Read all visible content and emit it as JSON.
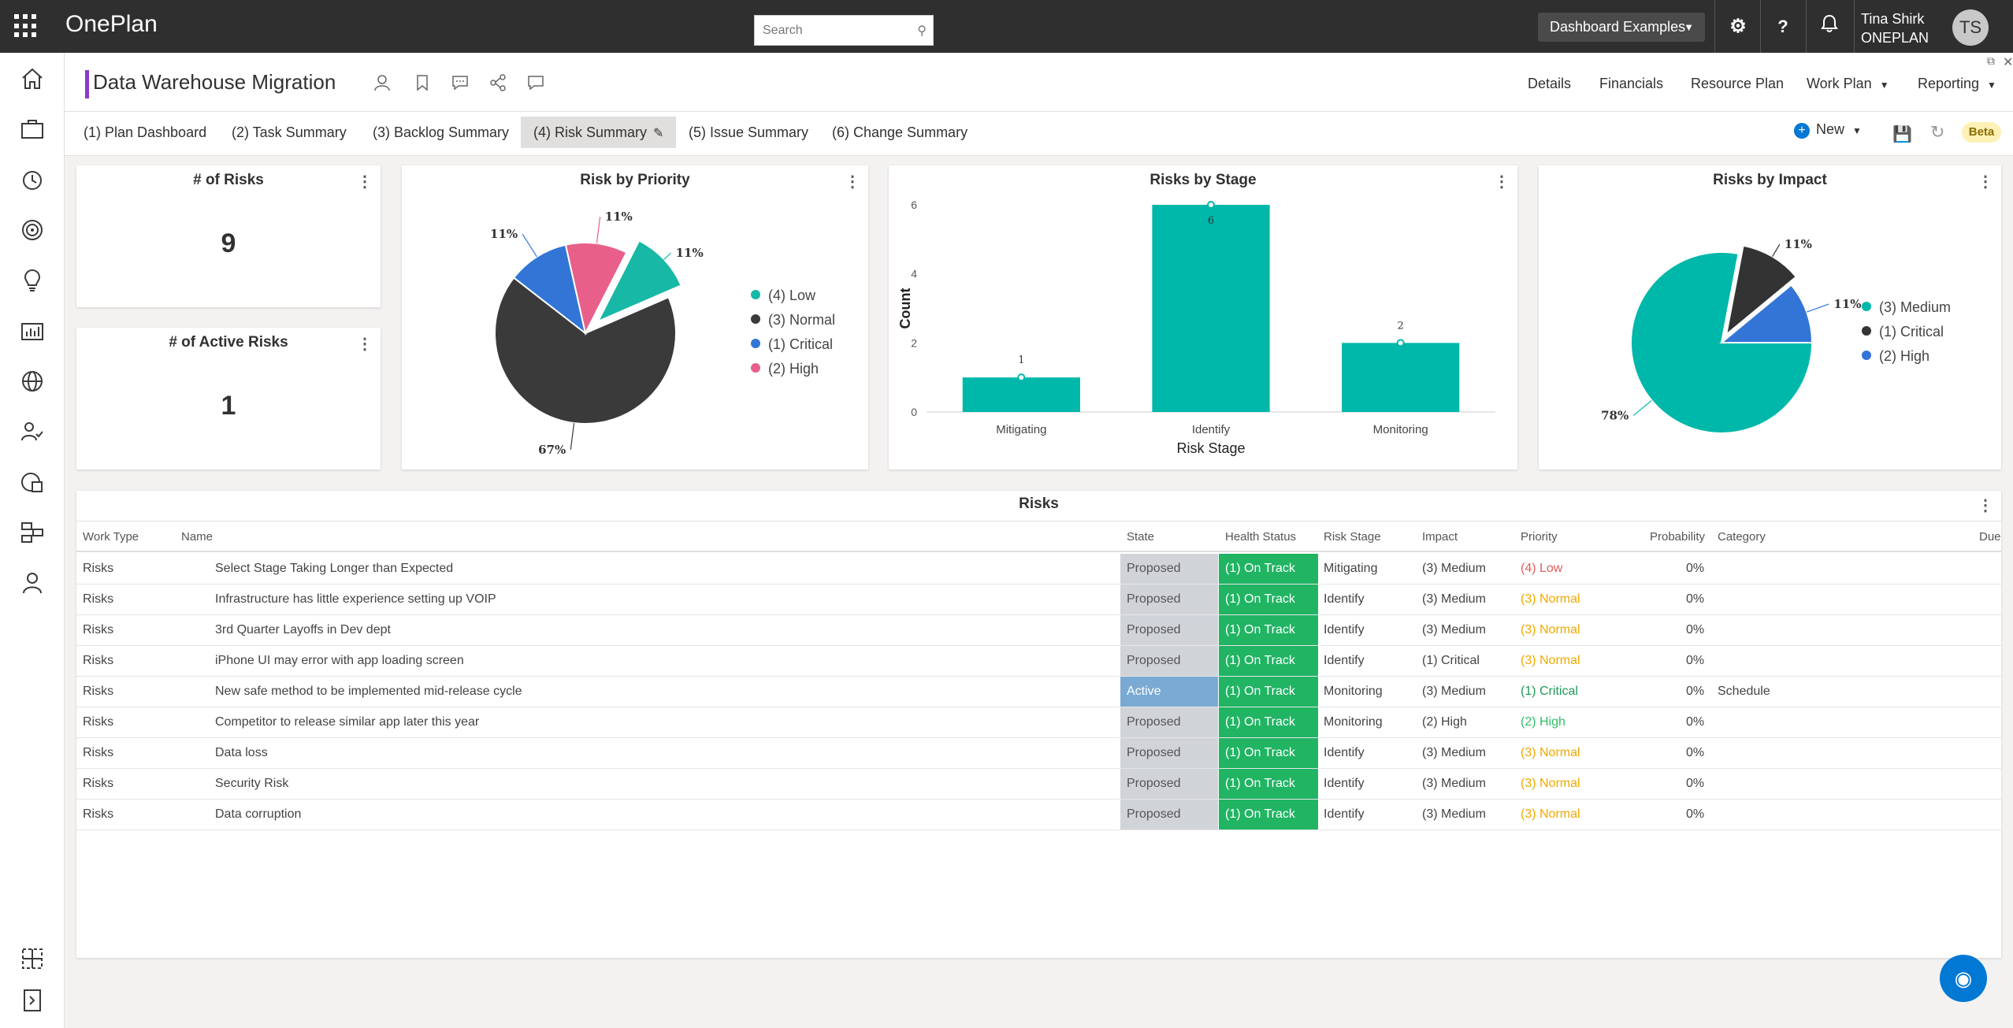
{
  "topbar": {
    "app_name": "OnePlan",
    "search_placeholder": "Search",
    "dashboard_selector": "Dashboard Examples",
    "user_name": "Tina Shirk",
    "user_org": "ONEPLAN",
    "avatar_initials": "TS"
  },
  "header": {
    "plan_title": "Data Warehouse Migration",
    "nav": [
      "Details",
      "Financials",
      "Resource Plan",
      "Work Plan",
      "Reporting"
    ],
    "accent_color": "#8a3ac7"
  },
  "tabs": [
    {
      "label": "(1) Plan Dashboard"
    },
    {
      "label": "(2) Task Summary"
    },
    {
      "label": "(3) Backlog Summary"
    },
    {
      "label": "(4) Risk Summary"
    },
    {
      "label": "(5) Issue Summary"
    },
    {
      "label": "(6) Change Summary"
    }
  ],
  "toolbar": {
    "new_label": "New",
    "beta_label": "Beta"
  },
  "kpis": {
    "risks_title": "# of Risks",
    "risks_value": "9",
    "active_title": "# of Active Risks",
    "active_value": "1"
  },
  "chart_data": [
    {
      "type": "pie",
      "title": "Risk by Priority",
      "slices": [
        {
          "label": "(4) Low",
          "value": 11,
          "color": "#17b8a6"
        },
        {
          "label": "(3) Normal",
          "value": 67,
          "color": "#3a3a3a"
        },
        {
          "label": "(1) Critical",
          "value": 11,
          "color": "#3275d6"
        },
        {
          "label": "(2) High",
          "value": 11,
          "color": "#e8608a"
        }
      ],
      "data_labels": [
        "11%",
        "67%",
        "11%",
        "11%"
      ],
      "legend_placement": "right"
    },
    {
      "type": "bar",
      "title": "Risks by Stage",
      "categories": [
        "Mitigating",
        "Identify",
        "Monitoring"
      ],
      "values": [
        1,
        6,
        2
      ],
      "xlabel": "Risk Stage",
      "ylabel": "Count",
      "ylim": [
        0,
        6
      ],
      "yticks": [
        "0",
        "2",
        "4",
        "6"
      ],
      "color": "#00b8a9",
      "grid": false
    },
    {
      "type": "pie",
      "title": "Risks by Impact",
      "slices": [
        {
          "label": "(3) Medium",
          "value": 78,
          "color": "#00b8a9"
        },
        {
          "label": "(1) Critical",
          "value": 11,
          "color": "#333333"
        },
        {
          "label": "(2) High",
          "value": 11,
          "color": "#3275d6"
        }
      ],
      "data_labels": [
        "78%",
        "11%",
        "11%"
      ],
      "legend_placement": "right"
    }
  ],
  "risks_table": {
    "title": "Risks",
    "columns": [
      "Work Type",
      "Name",
      "State",
      "Health Status",
      "Risk Stage",
      "Impact",
      "Priority",
      "Probability",
      "Category",
      "Due"
    ],
    "rows": [
      {
        "work_type": "Risks",
        "name": "Select Stage Taking Longer than Expected",
        "state": "Proposed",
        "health": "(1) On Track",
        "stage": "Mitigating",
        "impact": "(3) Medium",
        "priority": "(4) Low",
        "probability": "0%",
        "category": ""
      },
      {
        "work_type": "Risks",
        "name": "Infrastructure has little experience setting up VOIP",
        "state": "Proposed",
        "health": "(1) On Track",
        "stage": "Identify",
        "impact": "(3) Medium",
        "priority": "(3) Normal",
        "probability": "0%",
        "category": ""
      },
      {
        "work_type": "Risks",
        "name": "3rd Quarter Layoffs in Dev dept",
        "state": "Proposed",
        "health": "(1) On Track",
        "stage": "Identify",
        "impact": "(3) Medium",
        "priority": "(3) Normal",
        "probability": "0%",
        "category": ""
      },
      {
        "work_type": "Risks",
        "name": "iPhone UI may error with app loading screen",
        "state": "Proposed",
        "health": "(1) On Track",
        "stage": "Identify",
        "impact": "(1) Critical",
        "priority": "(3) Normal",
        "probability": "0%",
        "category": ""
      },
      {
        "work_type": "Risks",
        "name": "New safe method to be implemented mid-release cycle",
        "state": "Active",
        "health": "(1) On Track",
        "stage": "Monitoring",
        "impact": "(3) Medium",
        "priority": "(1) Critical",
        "probability": "0%",
        "category": "Schedule"
      },
      {
        "work_type": "Risks",
        "name": "Competitor to release similar app later this year",
        "state": "Proposed",
        "health": "(1) On Track",
        "stage": "Monitoring",
        "impact": "(2) High",
        "priority": "(2) High",
        "probability": "0%",
        "category": ""
      },
      {
        "work_type": "Risks",
        "name": "Data loss",
        "state": "Proposed",
        "health": "(1) On Track",
        "stage": "Identify",
        "impact": "(3) Medium",
        "priority": "(3) Normal",
        "probability": "0%",
        "category": ""
      },
      {
        "work_type": "Risks",
        "name": "Security Risk",
        "state": "Proposed",
        "health": "(1) On Track",
        "stage": "Identify",
        "impact": "(3) Medium",
        "priority": "(3) Normal",
        "probability": "0%",
        "category": ""
      },
      {
        "work_type": "Risks",
        "name": "Data corruption",
        "state": "Proposed",
        "health": "(1) On Track",
        "stage": "Identify",
        "impact": "(3) Medium",
        "priority": "(3) Normal",
        "probability": "0%",
        "category": ""
      }
    ],
    "colors": {
      "proposed_bg": "#d0d3d8",
      "active_bg": "#7aaad3",
      "on_track_bg": "#20b463",
      "low": "#e35d5d",
      "normal": "#f0a800",
      "critical": "#1e9a5a",
      "high": "#2fbf65"
    }
  }
}
